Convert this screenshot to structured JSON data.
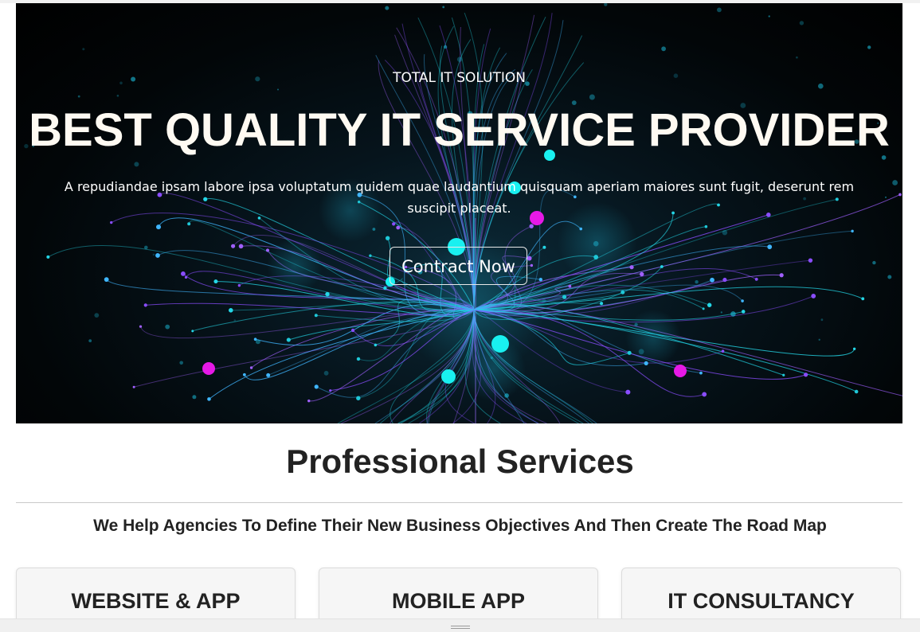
{
  "hero": {
    "subtitle": "TOTAL IT SOLUTION",
    "title": "BEST QUALITY IT SERVICE PROVIDER",
    "description": "A repudiandae ipsam labore ipsa voluptatum quidem quae laudantium quisquam aperiam maiores sunt fugit, deserunt rem suscipit placeat.",
    "cta_label": "Contract Now",
    "background_image": "network-lines-graphic"
  },
  "services": {
    "title": "Professional Services",
    "subtitle": "We Help Agencies To Define Their New Business Objectives And Then Create The Road Map",
    "cards": [
      {
        "title": "WEBSITE & APP"
      },
      {
        "title": "MOBILE APP"
      },
      {
        "title": "IT CONSULTANCY"
      }
    ]
  },
  "colors": {
    "hero_bg": "#000000",
    "cyan_accent": "#19e6e6",
    "magenta_accent": "#e619e6",
    "violet_lines": "#8a4dff",
    "text_dark": "#222222"
  },
  "icons": {
    "resize_handle": "grip-lines-icon"
  }
}
